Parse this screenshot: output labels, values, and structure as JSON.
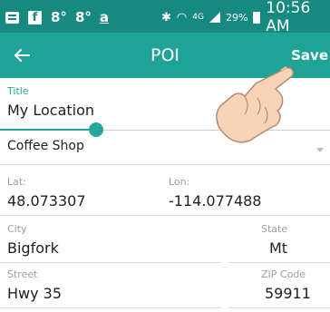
{
  "status_bar": {
    "icons": [
      "message-icon",
      "facebook-icon",
      "weather-icon",
      "weather-icon",
      "amazon-icon",
      "bluetooth-icon",
      "wifi-icon",
      "lte-icon",
      "signal-icon"
    ],
    "temp1": "8°",
    "temp2": "8°",
    "amazon_glyph": "a",
    "network": "4G",
    "battery": "29%",
    "time": "10:56 AM"
  },
  "toolbar": {
    "title": "POI",
    "save_label": "Save",
    "back_icon": "arrow-left-icon",
    "colors": {
      "toolbar": "#1fa397",
      "status": "#168a80",
      "accent": "#26a69a"
    }
  },
  "form": {
    "title_label": "Title",
    "title_value": "My Location",
    "category_value": "Coffee Shop",
    "lat_label": "Lat:",
    "lat_value": "48.073307",
    "lon_label": "Lon:",
    "lon_value": "-114.077488",
    "city_label": "City",
    "city_value": "Bigfork",
    "state_label": "State",
    "state_value": "Mt",
    "street_label": "Street",
    "street_value": "Hwy 35",
    "zip_label": "ZIP Code",
    "zip_value": "59911"
  }
}
